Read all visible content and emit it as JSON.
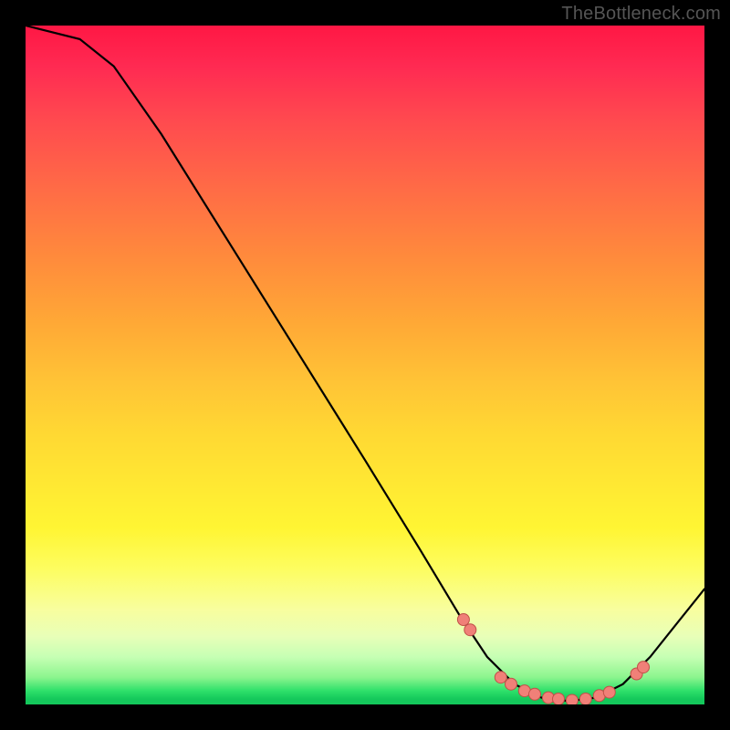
{
  "attribution": "TheBottleneck.com",
  "colors": {
    "frame": "#000000",
    "curve": "#000000",
    "marker_fill": "#f08078",
    "marker_stroke": "#c05048",
    "gradient_top": "#ff1744",
    "gradient_mid": "#ffe933",
    "gradient_bottom": "#14c85b"
  },
  "chart_data": {
    "type": "line",
    "title": "",
    "xlabel": "",
    "ylabel": "",
    "xlim": [
      0,
      100
    ],
    "ylim": [
      0,
      100
    ],
    "grid": false,
    "curve": [
      {
        "x": 0,
        "y": 100
      },
      {
        "x": 8,
        "y": 98
      },
      {
        "x": 13,
        "y": 94
      },
      {
        "x": 20,
        "y": 84
      },
      {
        "x": 30,
        "y": 68
      },
      {
        "x": 40,
        "y": 52
      },
      {
        "x": 50,
        "y": 36
      },
      {
        "x": 58,
        "y": 23
      },
      {
        "x": 64,
        "y": 13
      },
      {
        "x": 68,
        "y": 7
      },
      {
        "x": 72,
        "y": 3
      },
      {
        "x": 76,
        "y": 1
      },
      {
        "x": 80,
        "y": 0.5
      },
      {
        "x": 84,
        "y": 1
      },
      {
        "x": 88,
        "y": 3
      },
      {
        "x": 92,
        "y": 7
      },
      {
        "x": 96,
        "y": 12
      },
      {
        "x": 100,
        "y": 17
      }
    ],
    "markers": [
      {
        "x": 64.5,
        "y": 12.5
      },
      {
        "x": 65.5,
        "y": 11
      },
      {
        "x": 70,
        "y": 4
      },
      {
        "x": 71.5,
        "y": 3
      },
      {
        "x": 73.5,
        "y": 2
      },
      {
        "x": 75,
        "y": 1.5
      },
      {
        "x": 77,
        "y": 1
      },
      {
        "x": 78.5,
        "y": 0.8
      },
      {
        "x": 80.5,
        "y": 0.6
      },
      {
        "x": 82.5,
        "y": 0.8
      },
      {
        "x": 84.5,
        "y": 1.3
      },
      {
        "x": 86,
        "y": 1.8
      },
      {
        "x": 90,
        "y": 4.5
      },
      {
        "x": 91,
        "y": 5.5
      }
    ]
  }
}
